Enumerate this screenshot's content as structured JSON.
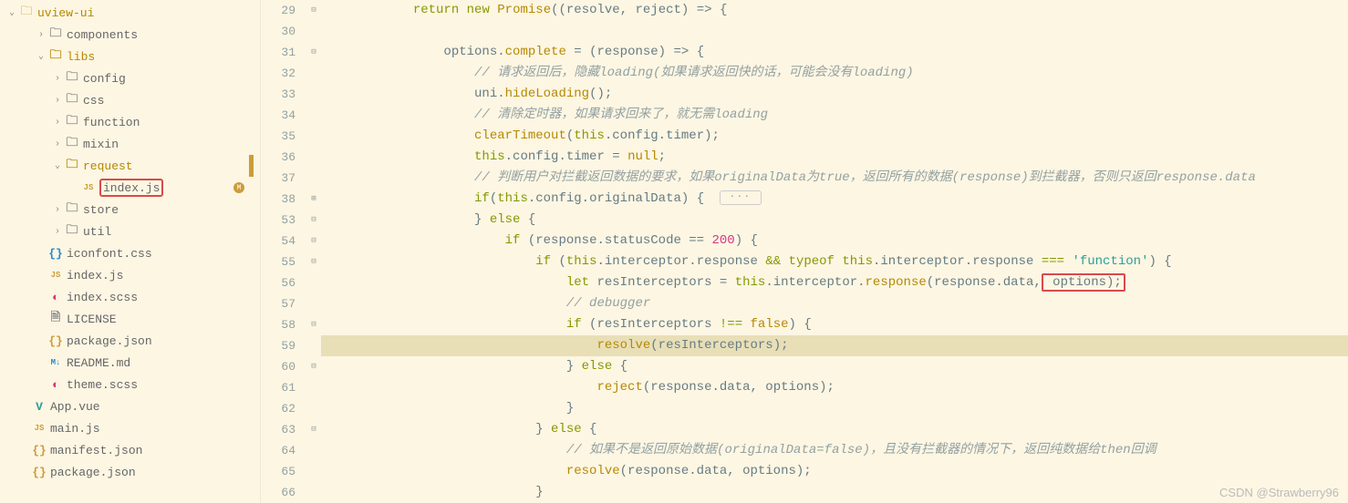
{
  "sidebar": {
    "root": "uview-ui",
    "items": [
      {
        "indent": 1,
        "chev": "›",
        "icon": "folder",
        "label": "components"
      },
      {
        "indent": 1,
        "chev": "⌄",
        "icon": "folder-open",
        "label": "libs"
      },
      {
        "indent": 2,
        "chev": "›",
        "icon": "folder",
        "label": "config"
      },
      {
        "indent": 2,
        "chev": "›",
        "icon": "folder",
        "label": "css"
      },
      {
        "indent": 2,
        "chev": "›",
        "icon": "folder",
        "label": "function"
      },
      {
        "indent": 2,
        "chev": "›",
        "icon": "folder",
        "label": "mixin"
      },
      {
        "indent": 2,
        "chev": "⌄",
        "icon": "folder-open",
        "label": "request",
        "strip": true
      },
      {
        "indent": 3,
        "chev": "",
        "icon": "js",
        "label": "index.js",
        "box": true,
        "tail": "M"
      },
      {
        "indent": 2,
        "chev": "›",
        "icon": "folder",
        "label": "store"
      },
      {
        "indent": 2,
        "chev": "›",
        "icon": "folder",
        "label": "util"
      },
      {
        "indent": 1,
        "chev": "",
        "icon": "css",
        "label": "iconfont.css"
      },
      {
        "indent": 1,
        "chev": "",
        "icon": "js",
        "label": "index.js"
      },
      {
        "indent": 1,
        "chev": "",
        "icon": "scss",
        "label": "index.scss"
      },
      {
        "indent": 1,
        "chev": "",
        "icon": "license",
        "label": "LICENSE"
      },
      {
        "indent": 1,
        "chev": "",
        "icon": "json",
        "label": "package.json"
      },
      {
        "indent": 1,
        "chev": "",
        "icon": "md",
        "label": "README.md"
      },
      {
        "indent": 1,
        "chev": "",
        "icon": "scss",
        "label": "theme.scss"
      },
      {
        "indent": 0,
        "chev": "",
        "icon": "vue",
        "label": "App.vue"
      },
      {
        "indent": 0,
        "chev": "",
        "icon": "js",
        "label": "main.js"
      },
      {
        "indent": 0,
        "chev": "",
        "icon": "json",
        "label": "manifest.json"
      },
      {
        "indent": 0,
        "chev": "",
        "icon": "json",
        "label": "package.json"
      }
    ]
  },
  "code": {
    "lines": [
      {
        "n": 29,
        "fold": "⊟",
        "html": "            <span class='c-keyword'>return</span> <span class='c-keyword'>new</span> <span class='c-type'>Promise</span>((resolve, reject) <span class='c-punct'>=&gt;</span> {"
      },
      {
        "n": 30,
        "fold": "",
        "html": ""
      },
      {
        "n": 31,
        "fold": "⊟",
        "html": "                options.<span class='c-func'>complete</span> = (response) <span class='c-punct'>=&gt;</span> {"
      },
      {
        "n": 32,
        "fold": "",
        "html": "                    <span class='c-comment'>// 请求返回后，隐藏loading(如果请求返回快的话，可能会没有loading)</span>"
      },
      {
        "n": 33,
        "fold": "",
        "html": "                    uni.<span class='c-func'>hideLoading</span>();"
      },
      {
        "n": 34,
        "fold": "",
        "html": "                    <span class='c-comment'>// 清除定时器，如果请求回来了，就无需loading</span>"
      },
      {
        "n": 35,
        "fold": "",
        "html": "                    <span class='c-func'>clearTimeout</span>(<span class='c-keyword'>this</span>.config.timer);"
      },
      {
        "n": 36,
        "fold": "",
        "html": "                    <span class='c-keyword'>this</span>.config.timer = <span class='c-null'>null</span>;"
      },
      {
        "n": 37,
        "fold": "",
        "html": "                    <span class='c-comment'>// 判断用户对拦截返回数据的要求，如果originalData为true，返回所有的数据(response)到拦截器，否则只返回response.data</span>"
      },
      {
        "n": 38,
        "fold": "⊞",
        "html": "                    <span class='c-keyword'>if</span>(<span class='c-keyword'>this</span>.config.originalData) {  <span class='fold-btn'>···</span>"
      },
      {
        "n": 53,
        "fold": "⊟",
        "html": "                    } <span class='c-keyword'>else</span> {"
      },
      {
        "n": 54,
        "fold": "⊟",
        "html": "                        <span class='c-keyword'>if</span> (response.statusCode == <span class='c-number'>200</span>) {"
      },
      {
        "n": 55,
        "fold": "⊟",
        "html": "                            <span class='c-keyword'>if</span> (<span class='c-keyword'>this</span>.interceptor.response <span class='c-keyword'>&amp;&amp;</span> <span class='c-keyword'>typeof</span> <span class='c-keyword'>this</span>.interceptor.response <span class='c-keyword'>===</span> <span class='c-string'>'function'</span>) {"
      },
      {
        "n": 56,
        "fold": "",
        "html": "                                <span class='c-let'>let</span> resInterceptors = <span class='c-keyword'>this</span>.interceptor.<span class='c-func'>response</span>(response.data,<span class='red-box'> options);</span>"
      },
      {
        "n": 57,
        "fold": "",
        "html": "                                <span class='c-comment'>// debugger</span>"
      },
      {
        "n": 58,
        "fold": "⊟",
        "html": "                                <span class='c-keyword'>if</span> (resInterceptors <span class='c-keyword'>!==</span> <span class='c-null'>false</span>) {"
      },
      {
        "n": 59,
        "fold": "",
        "hl": true,
        "html": "                                    <span class='c-func'>resolve</span>(resInterceptors);"
      },
      {
        "n": 60,
        "fold": "⊟",
        "html": "                                } <span class='c-keyword'>else</span> {"
      },
      {
        "n": 61,
        "fold": "",
        "html": "                                    <span class='c-func'>reject</span>(response.data, options);"
      },
      {
        "n": 62,
        "fold": "",
        "html": "                                }"
      },
      {
        "n": 63,
        "fold": "⊟",
        "html": "                            } <span class='c-keyword'>else</span> {"
      },
      {
        "n": 64,
        "fold": "",
        "html": "                                <span class='c-comment'>// 如果不是返回原始数据(originalData=false)，且没有拦截器的情况下，返回纯数据给then回调</span>"
      },
      {
        "n": 65,
        "fold": "",
        "html": "                                <span class='c-func'>resolve</span>(response.data, options);"
      },
      {
        "n": 66,
        "fold": "",
        "html": "                            }"
      }
    ]
  },
  "watermark": "CSDN @Strawberry96"
}
